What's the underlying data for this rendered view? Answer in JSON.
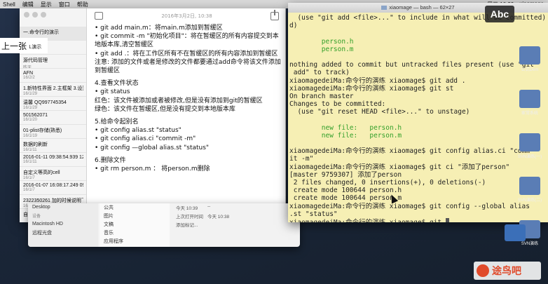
{
  "menubar": {
    "items": [
      "Shell",
      "编辑",
      "显示",
      "窗口",
      "帮助"
    ],
    "clock": "周三 10:39",
    "user": "xiaomage"
  },
  "overlay": {
    "label": "上一张",
    "small": "L演示"
  },
  "notes": {
    "list": [
      {
        "title": "一.命令行的演示",
        "date": ""
      },
      {
        "title": "L演示",
        "date": ""
      },
      {
        "title": "源代码管理",
        "date": "昨天"
      },
      {
        "title": "AFN",
        "date": "16/2/2"
      },
      {
        "title": "1.新特性界面 2.主框架 3.设置",
        "date": "16/1/29"
      },
      {
        "title": "温馨 QQ997745354",
        "date": "16/1/29"
      },
      {
        "title": "501562071",
        "date": "16/1/20"
      },
      {
        "title": "01-plist存储(熟悉)",
        "date": "16/1/19"
      },
      {
        "title": "数据的刷新",
        "date": "16/1/11"
      },
      {
        "title": "2016-01-11 09:38:54.939 12...",
        "date": "16/1/11"
      },
      {
        "title": "自定义等高的cell",
        "date": "16/1/7"
      },
      {
        "title": "2016-01-07 16:08:17.249 09...",
        "date": "16/1/7"
      },
      {
        "title": "2322350261 加的时候说明下...",
        "date": "16/1/4"
      },
      {
        "title": "自定义按钮的注意",
        "date": ""
      }
    ],
    "date_header": "2016年3月2日, 10:38",
    "body": [
      "• git add main.m：将main.m添加到暂缓区",
      "• git commit -m \"初始化项目\"：将在暂缓区的所有内容提交到本地版本库,清空暂缓区",
      "• git add .：将在工作区所有不在暂缓区的所有内容添加到暂缓区",
      "注意: 添加的文件或者是修改的文件都要通过add命令将该文件添加到暂缓区",
      "",
      "4.查看文件状态",
      "• git status",
      "红色：该文件被添加或者被修改,但是没有添加到git的暂缓区",
      "绿色：该文件在暂缓区,但是没有提交到本地版本库",
      "",
      "5.给命令起别名",
      "• git config alias.st \"status\"",
      "• git config alias.ci \"commit -m\"",
      "• git config —global alias.st \"status\"",
      "",
      "6.删除文件",
      "• git rm person.m ： 将person.m删除"
    ]
  },
  "finder": {
    "sidebar": [
      "Desktop",
      "设备",
      "Macintosh HD",
      "远程光盘"
    ],
    "folders": [
      "公共",
      "图片",
      "文稿",
      "音乐",
      "应用程序"
    ],
    "rows": [
      {
        "a": "今天 10:39",
        "b": "--"
      },
      {
        "a": "上次打开时间",
        "b": "今天 10:38"
      },
      {
        "a": "添加标记...",
        "b": ""
      }
    ]
  },
  "terminal": {
    "title": "xiaomage — bash — 62×27",
    "lines": [
      {
        "text": "  (use \"git add <file>...\" to include in what will be committed)",
        "color": ""
      },
      {
        "text": "d)",
        "color": ""
      },
      {
        "text": "",
        "color": ""
      },
      {
        "text": "        person.h",
        "color": "green"
      },
      {
        "text": "        person.m",
        "color": "green"
      },
      {
        "text": "",
        "color": ""
      },
      {
        "text": "nothing added to commit but untracked files present (use \"git",
        "color": ""
      },
      {
        "text": " add\" to track)",
        "color": ""
      },
      {
        "text": "xiaomagedeiMa:命令行的演练 xiaomage$ git add .",
        "color": ""
      },
      {
        "text": "xiaomagedeiMa:命令行的演练 xiaomage$ git st",
        "color": ""
      },
      {
        "text": "On branch master",
        "color": ""
      },
      {
        "text": "Changes to be committed:",
        "color": ""
      },
      {
        "text": "  (use \"git reset HEAD <file>...\" to unstage)",
        "color": ""
      },
      {
        "text": "",
        "color": ""
      },
      {
        "text": "        new file:   person.h",
        "color": "green"
      },
      {
        "text": "        new file:   person.m",
        "color": "green"
      },
      {
        "text": "",
        "color": ""
      },
      {
        "text": "xiaomagedeiMa:命令行的演练 xiaomage$ git config alias.ci \"comm",
        "color": ""
      },
      {
        "text": "it -m\"",
        "color": ""
      },
      {
        "text": "xiaomagedeiMa:命令行的演练 xiaomage$ git ci \"添加了person\"",
        "color": ""
      },
      {
        "text": "[master 9759307] 添加了person",
        "color": ""
      },
      {
        "text": " 2 files changed, 0 insertions(+), 0 deletions(-)",
        "color": ""
      },
      {
        "text": " create mode 100644 person.h",
        "color": ""
      },
      {
        "text": " create mode 100644 person.m",
        "color": ""
      },
      {
        "text": "xiaomagedeiMa:命令行的演练 xiaomage$ git config --global alias",
        "color": ""
      },
      {
        "text": ".st \"status\"",
        "color": ""
      },
      {
        "text": "xiaomagedeiMa:命令行的演练 xiaomage$ git ",
        "color": ""
      }
    ]
  },
  "badge": "Abc",
  "desktop_icons": [
    "公式Dem",
    "家常系统",
    "SVN演练(一)",
    "SVN演练(二)",
    "SVN演练"
  ],
  "watermark": "途鸟吧"
}
